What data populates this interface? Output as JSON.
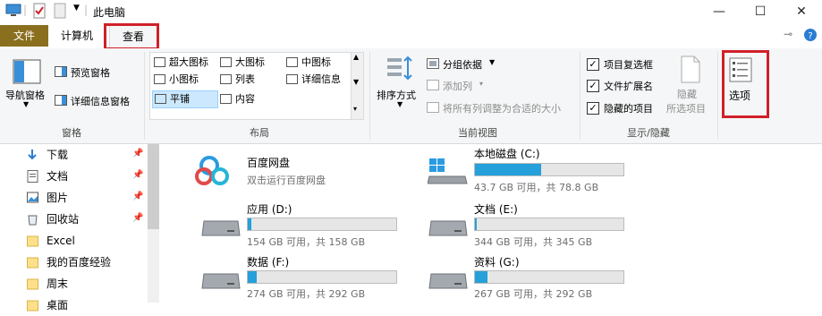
{
  "window": {
    "title": "此电脑",
    "controls": {
      "minimize": "—",
      "maximize": "☐",
      "close": "✕"
    }
  },
  "tabs": {
    "file": "文件",
    "computer": "计算机",
    "view": "查看"
  },
  "ribbon": {
    "pane": {
      "nav_pane": "导航窗格",
      "preview": "预览窗格",
      "details": "详细信息窗格",
      "group": "窗格"
    },
    "layout": {
      "items": [
        "超大图标",
        "大图标",
        "中图标",
        "小图标",
        "列表",
        "详细信息",
        "平铺",
        "内容"
      ],
      "selected": "平铺",
      "group": "布局"
    },
    "current_view": {
      "sort": "排序方式",
      "group_by": "分组依据",
      "add_column": "添加列",
      "fit_columns": "将所有列调整为合适的大小",
      "group": "当前视图"
    },
    "show_hide": {
      "item_checkbox": "项目复选框",
      "file_ext": "文件扩展名",
      "hidden_items": "隐藏的项目",
      "hide": "隐藏",
      "hide_selected": "所选项目",
      "group": "显示/隐藏"
    },
    "options": "选项"
  },
  "nav": {
    "items": [
      {
        "label": "下载",
        "icon": "download-icon",
        "pinned": true
      },
      {
        "label": "文档",
        "icon": "document-icon",
        "pinned": true
      },
      {
        "label": "图片",
        "icon": "picture-icon",
        "pinned": true
      },
      {
        "label": "回收站",
        "icon": "recycle-bin-icon",
        "pinned": true
      },
      {
        "label": "Excel",
        "icon": "folder-icon",
        "pinned": false
      },
      {
        "label": "我的百度经验",
        "icon": "folder-icon",
        "pinned": false
      },
      {
        "label": "周末",
        "icon": "folder-icon",
        "pinned": false
      },
      {
        "label": "桌面",
        "icon": "folder-icon",
        "pinned": false
      }
    ]
  },
  "drives": {
    "baidu": {
      "name": "百度网盘",
      "sub": "双击运行百度网盘"
    },
    "c": {
      "name": "本地磁盘 (C:)",
      "info": "43.7 GB 可用，共 78.8 GB",
      "used_fraction": 0.445
    },
    "d": {
      "name": "应用 (D:)",
      "info": "154 GB 可用，共 158 GB",
      "used_fraction": 0.025
    },
    "e": {
      "name": "文档 (E:)",
      "info": "344 GB 可用，共 345 GB",
      "used_fraction": 0.01
    },
    "f": {
      "name": "数据 (F:)",
      "info": "274 GB 可用，共 292 GB",
      "used_fraction": 0.06
    },
    "g": {
      "name": "资料 (G:)",
      "info": "267 GB 可用，共 292 GB",
      "used_fraction": 0.085
    }
  },
  "colors": {
    "accent": "#26a0da",
    "file_tab": "#8a6f1f",
    "highlight_box": "#d0202a"
  }
}
